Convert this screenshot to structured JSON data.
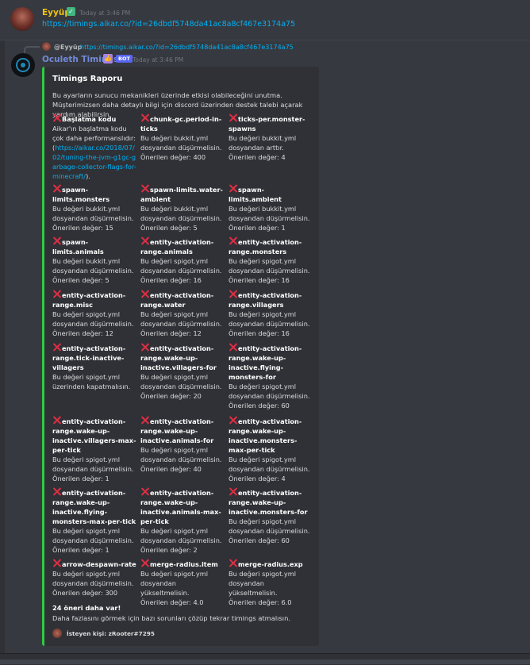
{
  "message1": {
    "author": "Eyyüp",
    "badge": "✓",
    "timestamp": "Today at 3:46 PM",
    "link": "https://timings.aikar.co/?id=26dbdf5748da41ac8a8cf467e3174a75"
  },
  "reply": {
    "author": "@Eyyüp",
    "link": "https://timings.aikar.co/?id=26dbdf5748da41ac8a8cf467e3174a75"
  },
  "message2": {
    "author": "Oculeth Timings",
    "emoji": "👍",
    "bot_tag": "BOT",
    "timestamp": "Today at 3:46 PM"
  },
  "embed": {
    "title": "Timings Raporu",
    "description": "Bu ayarların sunucu mekanikleri üzerinde etkisi olabileceğini unutma. Müşterimizsen daha detaylı bilgi için discord üzerinden destek talebi açarak yardım alabilirsin.",
    "fields": [
      {
        "name": "Başlatma kodu",
        "lines": [
          "Aikar'ın başlatma kodu çok daha performanslıdır:"
        ],
        "link": "https://aikar.co/2018/07/02/tuning-the-jvm-g1gc-garbage-collector-flags-for-minecraft/",
        "after": ")."
      },
      {
        "name": "chunk-gc.period-in-ticks",
        "lines": [
          "Bu değeri bukkit.yml dosyandan düşürmelisin.",
          "Önerilen değer: 400"
        ]
      },
      {
        "name": "ticks-per.monster-spawns",
        "lines": [
          "Bu değeri bukkit.yml dosyandan arttır.",
          "Önerilen değer: 4"
        ]
      },
      {
        "name": "spawn-limits.monsters",
        "lines": [
          "Bu değeri bukkit.yml dosyandan düşürmelisin.",
          "Önerilen değer: 15"
        ]
      },
      {
        "name": "spawn-limits.water-ambient",
        "lines": [
          "Bu değeri bukkit.yml dosyandan düşürmelisin.",
          "Önerilen değer: 5"
        ]
      },
      {
        "name": "spawn-limits.ambient",
        "lines": [
          "Bu değeri bukkit.yml dosyandan düşürmelisin.",
          "Önerilen değer: 1"
        ]
      },
      {
        "name": "spawn-limits.animals",
        "lines": [
          "Bu değeri bukkit.yml dosyandan düşürmelisin.",
          "Önerilen değer: 5"
        ]
      },
      {
        "name": "entity-activation-range.animals",
        "lines": [
          "Bu değeri spigot.yml dosyandan düşürmelisin.",
          "Önerilen değer: 16"
        ]
      },
      {
        "name": "entity-activation-range.monsters",
        "lines": [
          "Bu değeri spigot.yml dosyandan düşürmelisin.",
          "Önerilen değer: 16"
        ]
      },
      {
        "name": "entity-activation-range.misc",
        "lines": [
          "Bu değeri spigot.yml dosyandan düşürmelisin.",
          "Önerilen değer: 12"
        ]
      },
      {
        "name": "entity-activation-range.water",
        "lines": [
          "Bu değeri spigot.yml dosyandan düşürmelisin.",
          "Önerilen değer: 12"
        ]
      },
      {
        "name": "entity-activation-range.villagers",
        "lines": [
          "Bu değeri spigot.yml dosyandan düşürmelisin.",
          "Önerilen değer: 16"
        ]
      },
      {
        "name": "entity-activation-range.tick-inactive-villagers",
        "lines": [
          "Bu değeri spigot.yml üzerinden kapatmalısın."
        ]
      },
      {
        "name": "entity-activation-range.wake-up-inactive.villagers-for",
        "lines": [
          "Bu değeri spigot.yml dosyandan düşürmelisin.",
          "Önerilen değer: 20"
        ]
      },
      {
        "name": "entity-activation-range.wake-up-inactive.flying-monsters-for",
        "lines": [
          "Bu değeri spigot.yml dosyandan düşürmelisin.",
          "Önerilen değer: 60"
        ]
      },
      {
        "name": "entity-activation-range.wake-up-inactive.villagers-max-per-tick",
        "lines": [
          "Bu değeri spigot.yml dosyandan düşürmelisin.",
          "Önerilen değer: 1"
        ]
      },
      {
        "name": "entity-activation-range.wake-up-inactive.animals-for",
        "lines": [
          "Bu değeri spigot.yml dosyandan düşürmelisin.",
          "Önerilen değer: 40"
        ]
      },
      {
        "name": "entity-activation-range.wake-up-inactive.monsters-max-per-tick",
        "lines": [
          "Bu değeri spigot.yml dosyandan düşürmelisin.",
          "Önerilen değer: 4"
        ]
      },
      {
        "name": "entity-activation-range.wake-up-inactive.flying-monsters-max-per-tick",
        "lines": [
          "Bu değeri spigot.yml dosyandan düşürmelisin.",
          "Önerilen değer: 1"
        ]
      },
      {
        "name": "entity-activation-range.wake-up-inactive.animals-max-per-tick",
        "lines": [
          "Bu değeri spigot.yml dosyandan düşürmelisin.",
          "Önerilen değer: 2"
        ]
      },
      {
        "name": "entity-activation-range.wake-up-inactive.monsters-for",
        "lines": [
          "Bu değeri spigot.yml dosyandan düşürmelisin.",
          "Önerilen değer: 60"
        ]
      },
      {
        "name": "arrow-despawn-rate",
        "lines": [
          "Bu değeri spigot.yml dosyandan düşürmelisin.",
          "Önerilen değer: 300"
        ]
      },
      {
        "name": "merge-radius.item",
        "lines": [
          "Bu değeri spigot.yml dosyandan yükseltmelisin.",
          "Önerilen değer: 4.0"
        ]
      },
      {
        "name": "merge-radius.exp",
        "lines": [
          "Bu değeri spigot.yml dosyandan yükseltmelisin.",
          "Önerilen değer: 6.0"
        ]
      }
    ],
    "summary_title": "24 öneri daha var!",
    "summary_text": "Daha fazlasını görmek için bazı sorunları çözüp tekrar timings atmalısın.",
    "footer": "İsteyen kişi: zRooter#7295"
  },
  "colors": {
    "background": "#36393f",
    "embed_border": "#2ecc40",
    "link": "#00b0f4",
    "error_icon": "#dd2e44"
  }
}
